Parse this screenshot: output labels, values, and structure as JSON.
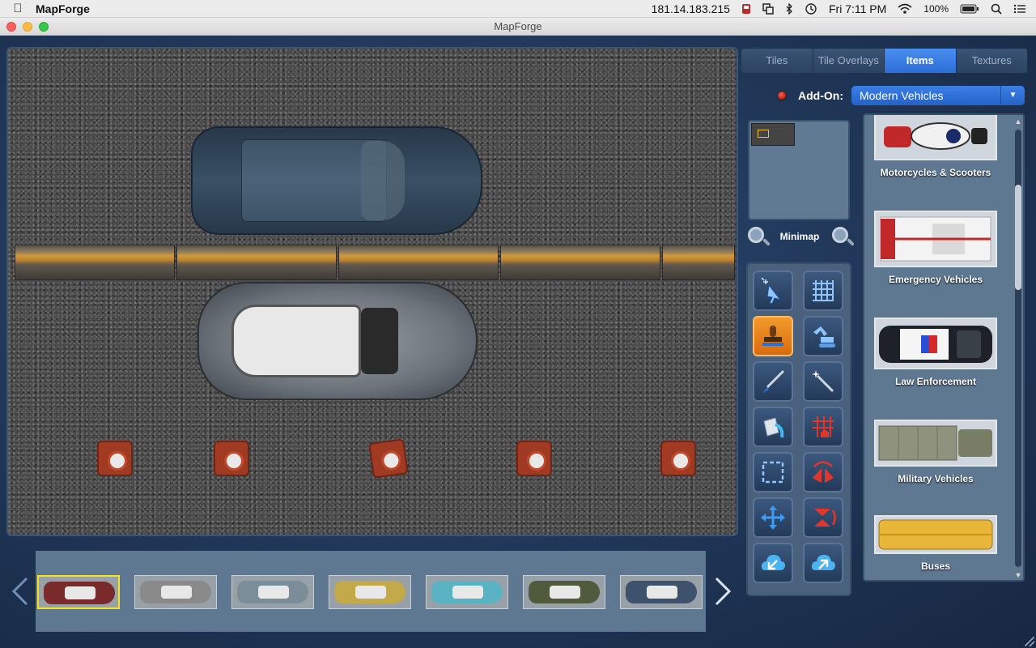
{
  "menubar": {
    "app_name": "MapForge",
    "ip": "181.14.183.215",
    "clock": "Fri 7:11 PM",
    "battery": "100%",
    "icons": [
      "apple-icon",
      "flashcard-icon",
      "window-icon",
      "bluetooth-icon",
      "time-machine-icon",
      "wifi-icon",
      "battery-icon",
      "spotlight-icon",
      "notification-center-icon"
    ]
  },
  "window": {
    "title": "MapForge"
  },
  "tabs": [
    {
      "label": "Tiles",
      "active": false
    },
    {
      "label": "Tile Overlays",
      "active": false
    },
    {
      "label": "Items",
      "active": true
    },
    {
      "label": "Textures",
      "active": false
    }
  ],
  "addon": {
    "label": "Add-On:",
    "selected": "Modern Vehicles"
  },
  "minimap": {
    "label": "Minimap"
  },
  "tools": [
    {
      "name": "select-tool"
    },
    {
      "name": "grid-tool"
    },
    {
      "name": "stamp-tool",
      "active": true
    },
    {
      "name": "excavator-tool"
    },
    {
      "name": "brush-tool"
    },
    {
      "name": "magic-wand-tool"
    },
    {
      "name": "paint-bucket-tool"
    },
    {
      "name": "tile-grid-tool"
    },
    {
      "name": "marquee-select-tool"
    },
    {
      "name": "flip-horizontal-tool"
    },
    {
      "name": "move-tool"
    },
    {
      "name": "flip-vertical-tool"
    },
    {
      "name": "import-tool"
    },
    {
      "name": "export-tool"
    }
  ],
  "catalog": {
    "items": [
      {
        "label": "Motorcycles & Scooters"
      },
      {
        "label": "Emergency Vehicles"
      },
      {
        "label": "Law Enforcement"
      },
      {
        "label": "Military Vehicles"
      },
      {
        "label": "Buses"
      }
    ]
  },
  "filmstrip": {
    "selected_index": 0,
    "items": [
      {
        "color": "#7a2a2a"
      },
      {
        "color": "#8a8a8a"
      },
      {
        "color": "#7c8d9a"
      },
      {
        "color": "#c3a94a"
      },
      {
        "color": "#5ab3c3"
      },
      {
        "color": "#4f5b3c"
      },
      {
        "color": "#3e526e"
      }
    ]
  },
  "colors": {
    "accent": "#2d6ed8",
    "active_tool": "#e77d1a",
    "selection": "#f5e21c"
  }
}
